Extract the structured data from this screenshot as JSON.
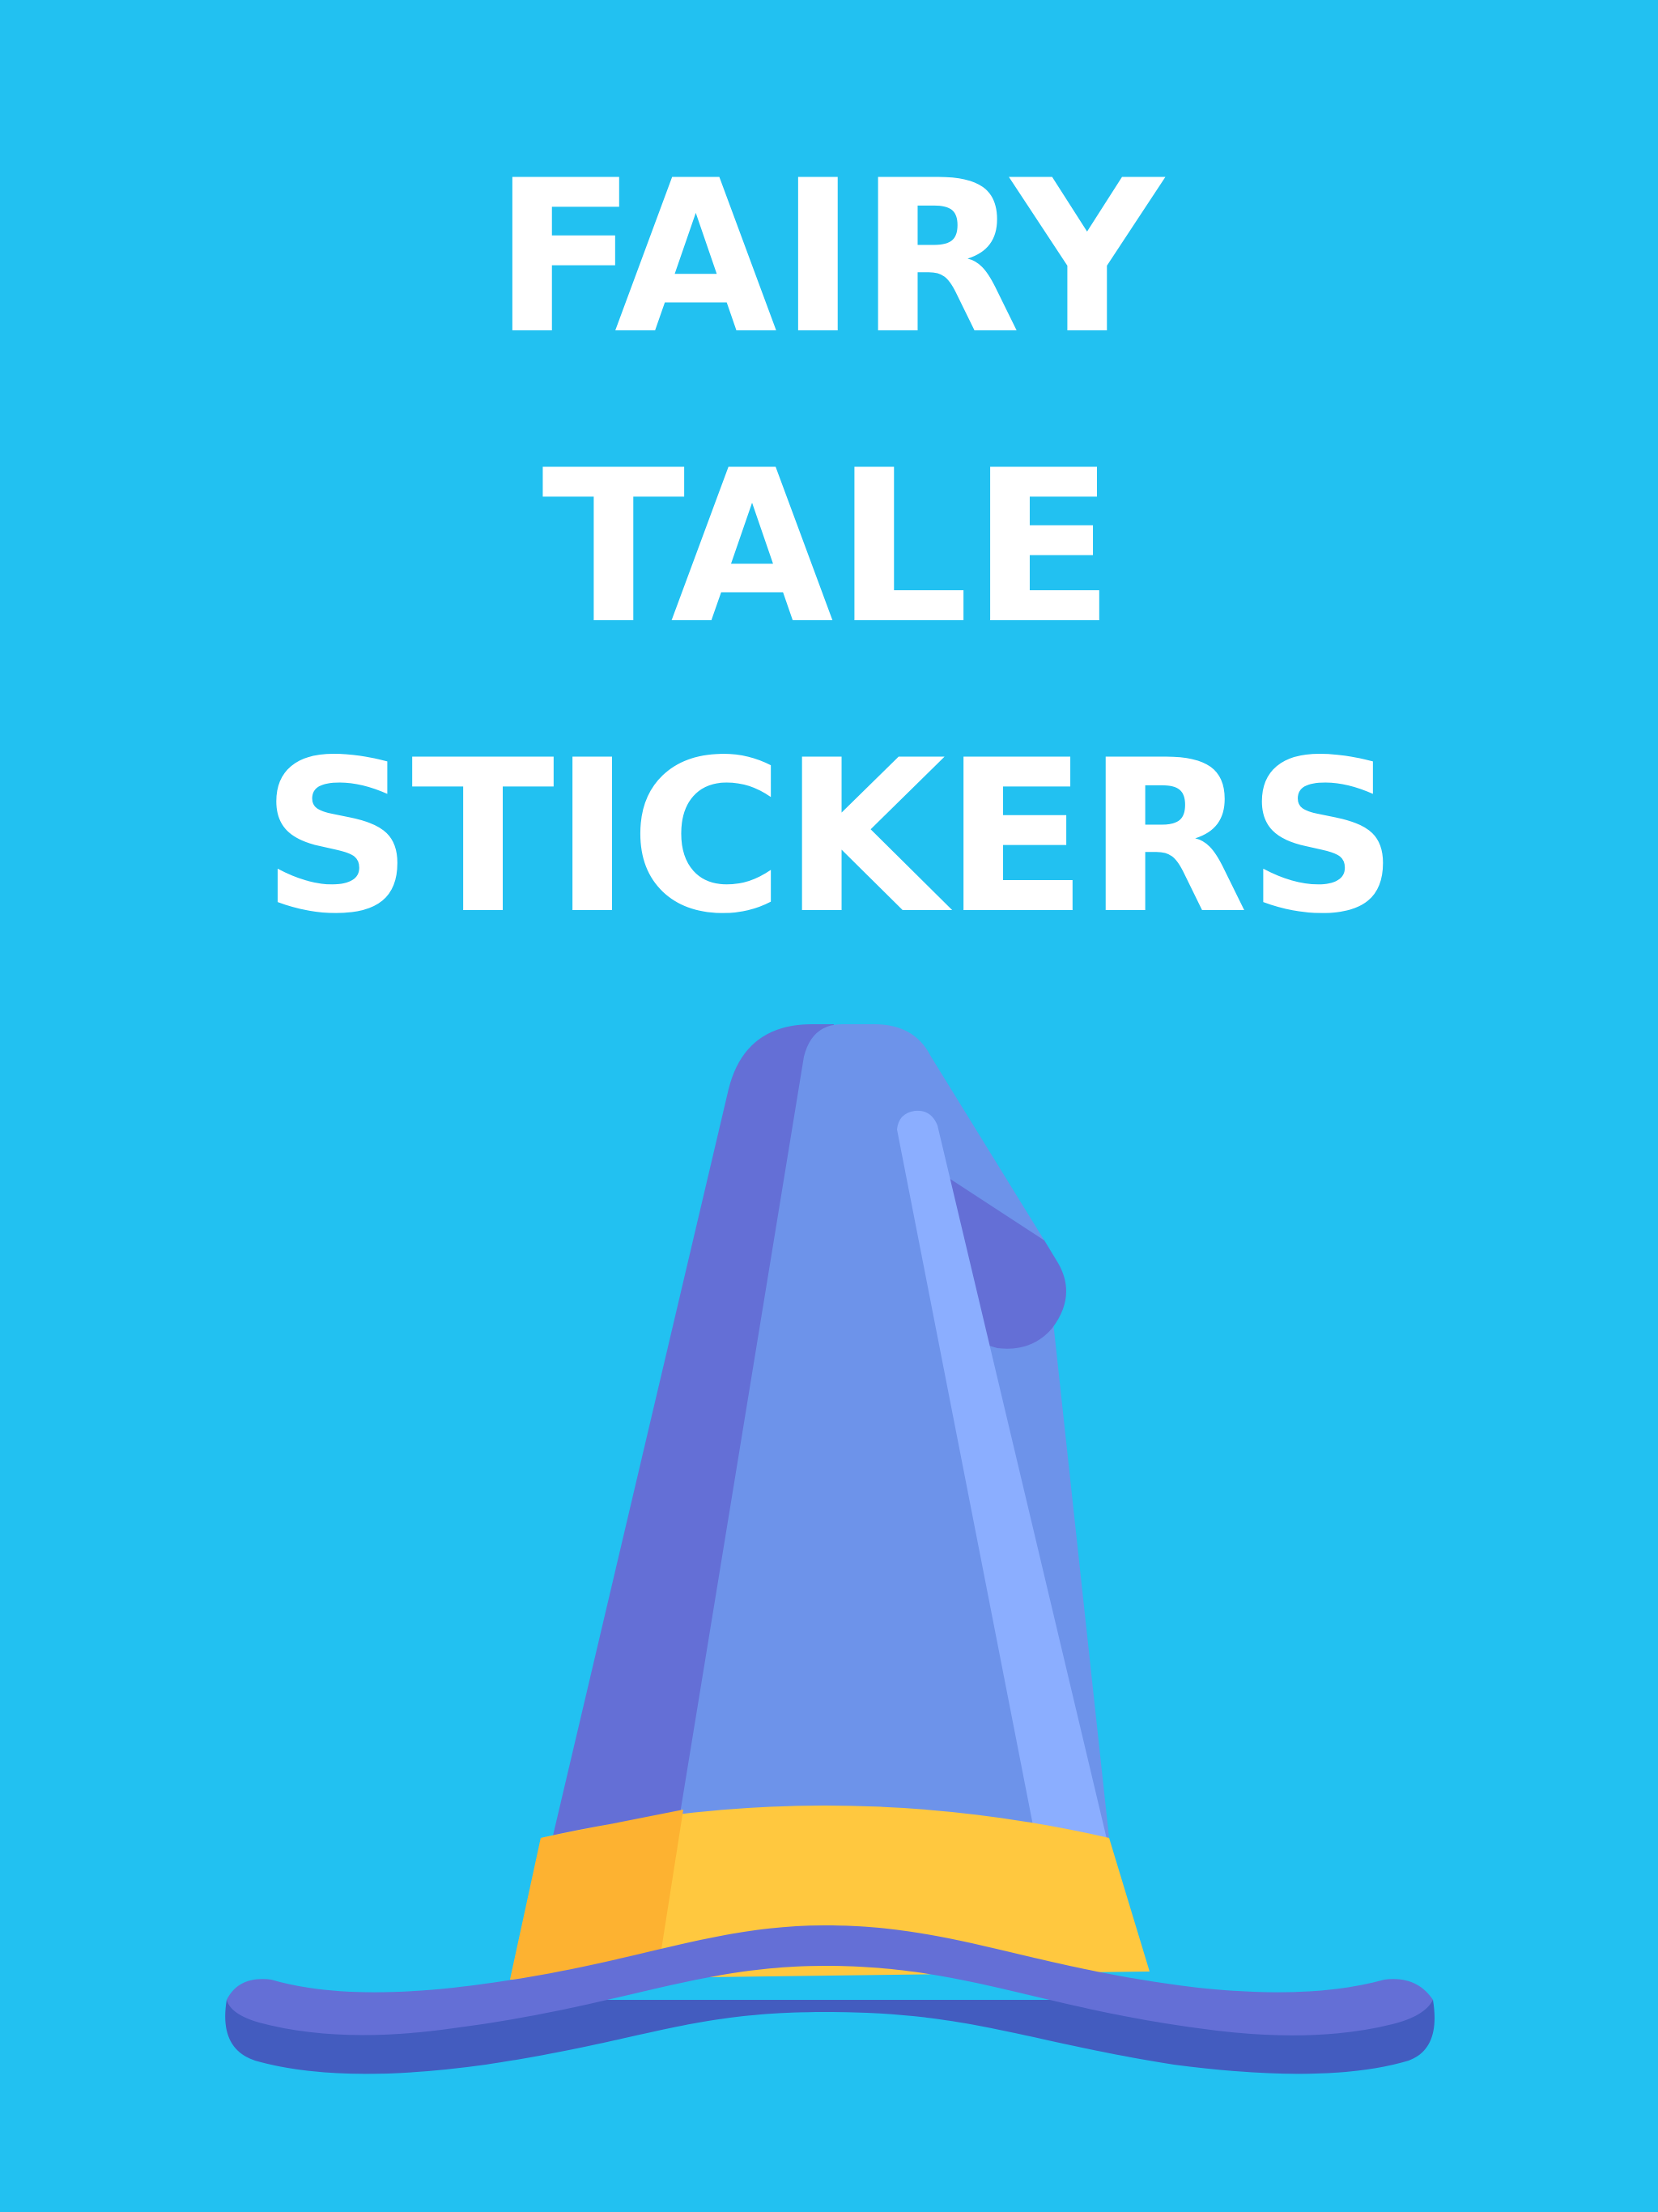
{
  "title": {
    "line1": "FAIRY",
    "line2": "TALE",
    "line3": "STICKERS"
  },
  "colors": {
    "background": "#22C1F1",
    "text": "#FFFFFF",
    "hat_light": "#6D93EA",
    "hat_dark": "#646FD6",
    "hat_highlight": "#8BAEFF",
    "band_yellow": "#FFC83F",
    "band_orange": "#FDB231",
    "brim_dark": "#435CBF"
  },
  "illustration": {
    "icon": "wizard-hat-icon"
  }
}
